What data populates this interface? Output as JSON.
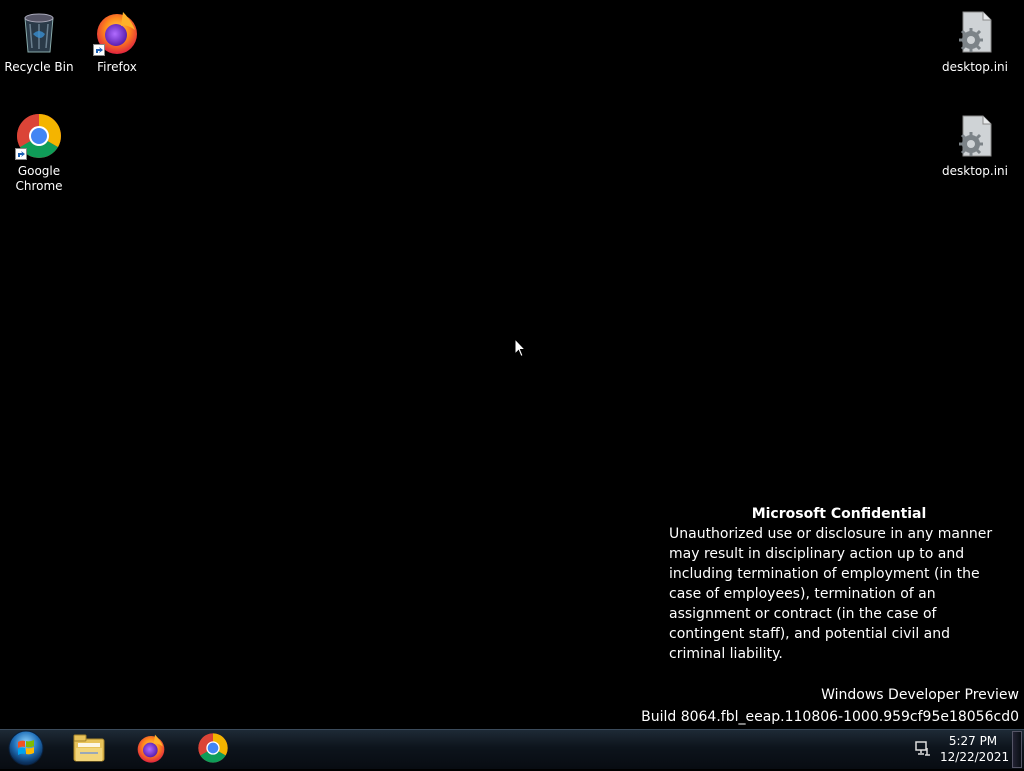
{
  "desktop": {
    "icons": [
      {
        "label": "Recycle Bin",
        "icon": "recycle-bin-icon"
      },
      {
        "label": "Firefox",
        "icon": "firefox-icon"
      },
      {
        "label": "Google Chrome",
        "icon": "chrome-icon"
      },
      {
        "label": "desktop.ini",
        "icon": "settings-file-icon"
      },
      {
        "label": "desktop.ini",
        "icon": "settings-file-icon"
      }
    ]
  },
  "watermark": {
    "title": "Microsoft Confidential",
    "body": "Unauthorized use or disclosure in any manner may result in disciplinary action up to and including termination of employment (in the case of employees), termination of an assignment or contract (in the case of contingent staff), and potential civil and criminal liability.",
    "product": "Windows Developer Preview",
    "build": "Build 8064.fbl_eeap.110806-1000.959cf95e18056cd0"
  },
  "taskbar": {
    "start_icon": "windows-start-orb-icon",
    "pinned": [
      {
        "icon": "file-explorer-icon"
      },
      {
        "icon": "firefox-icon"
      },
      {
        "icon": "chrome-icon"
      }
    ],
    "clock": {
      "time": "5:27 PM",
      "date": "12/22/2021"
    },
    "tray_icon": "network-icon"
  },
  "colors": {
    "background": "#000000",
    "taskbar": "#0d141c",
    "text": "#ffffff"
  }
}
